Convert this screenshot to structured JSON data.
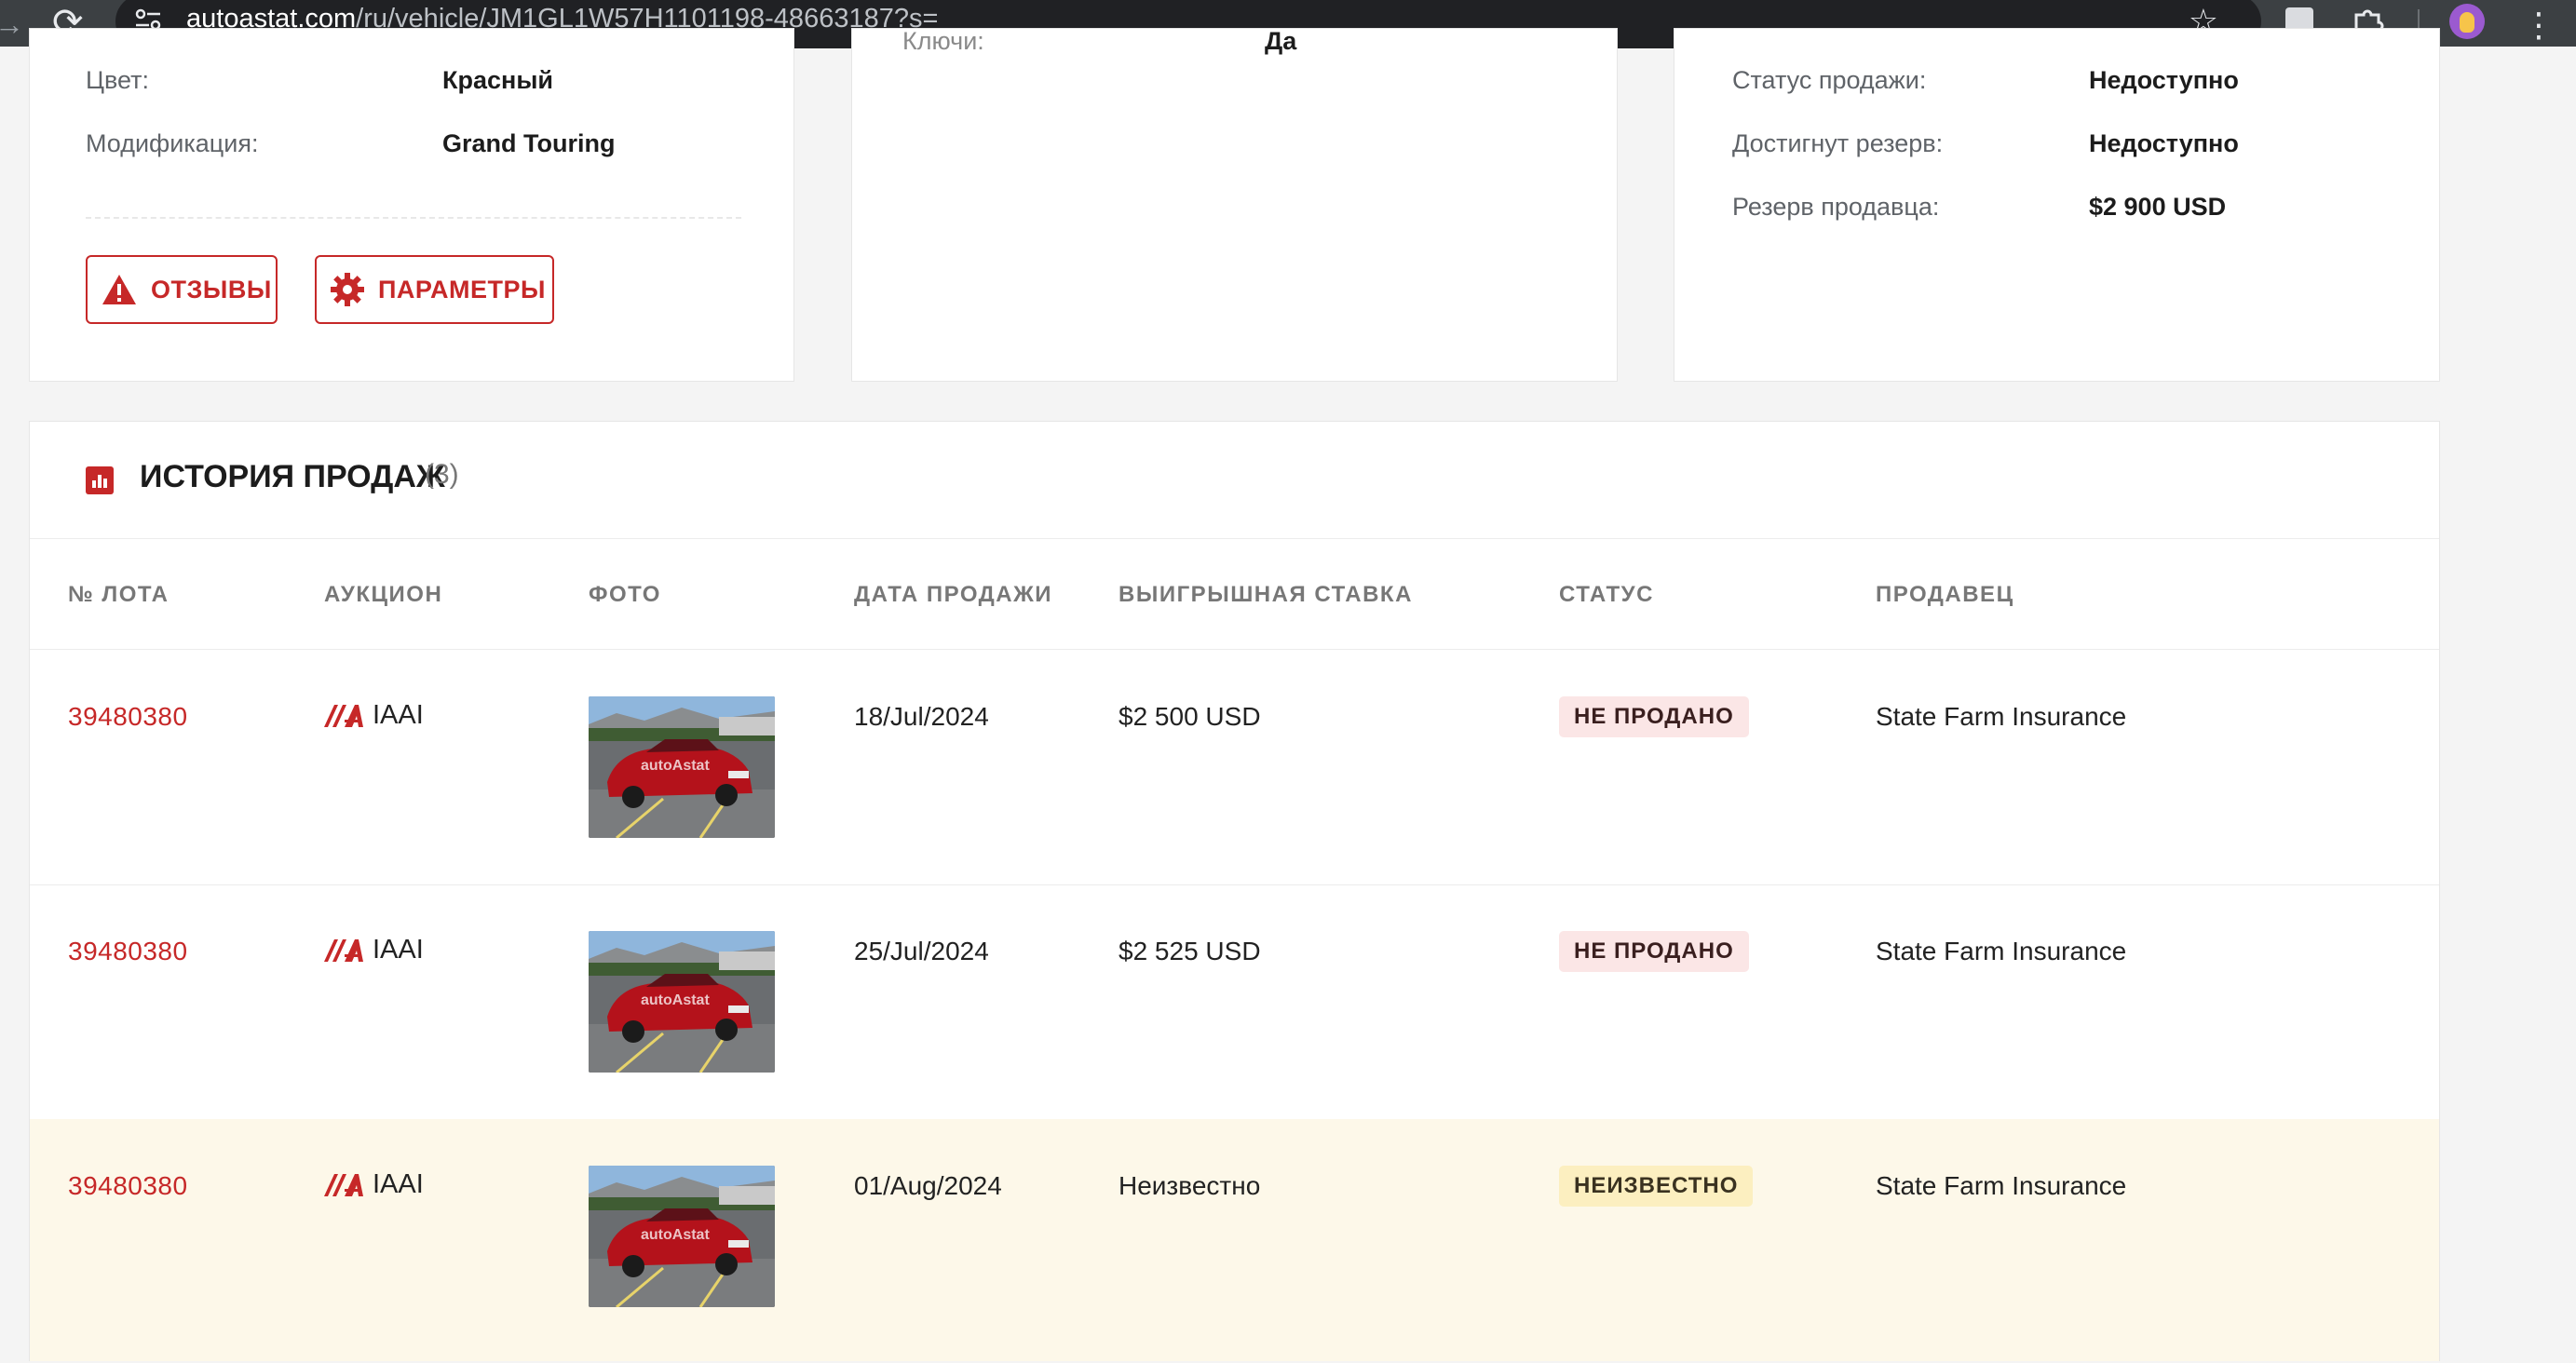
{
  "browser": {
    "url_host": "autoastat.com",
    "url_rest": "/ru/vehicle/JM1GL1W57H1101198-48663187?s="
  },
  "card1": {
    "rows": [
      {
        "label": "Цвет:",
        "value": "Красный"
      },
      {
        "label": "Модификация:",
        "value": "Grand Touring"
      }
    ],
    "buttons": {
      "reviews": "ОТЗЫВЫ",
      "params": "ПАРАМЕТРЫ"
    }
  },
  "card2": {
    "partial_label": "Ключи:",
    "partial_value": "Да"
  },
  "card3": {
    "rows": [
      {
        "label": "Статус продажи:",
        "value": "Недоступно"
      },
      {
        "label": "Достигнут резерв:",
        "value": "Недоступно"
      },
      {
        "label": "Резерв продавца:",
        "value": "$2 900 USD"
      }
    ]
  },
  "history": {
    "title": "ИСТОРИЯ ПРОДАЖ",
    "count": "(3)",
    "columns": [
      "№ ЛОТА",
      "АУКЦИОН",
      "ФОТО",
      "ДАТА ПРОДАЖИ",
      "ВЫИГРЫШНАЯ СТАВКА",
      "СТАТУС",
      "ПРОДАВЕЦ"
    ],
    "photo_watermark": "autoAstat",
    "rows": [
      {
        "lot": "39480380",
        "auction": "IAAI",
        "date": "18/Jul/2024",
        "bid": "$2 500 USD",
        "status": "НЕ ПРОДАНО",
        "seller": "State Farm Insurance"
      },
      {
        "lot": "39480380",
        "auction": "IAAI",
        "date": "25/Jul/2024",
        "bid": "$2 525 USD",
        "status": "НЕ ПРОДАНО",
        "seller": "State Farm Insurance"
      },
      {
        "lot": "39480380",
        "auction": "IAAI",
        "date": "01/Aug/2024",
        "bid": "Неизвестно",
        "status": "НЕИЗВЕСТНО",
        "seller": "State Farm Insurance"
      }
    ]
  },
  "colors": {
    "accent": "#c62828",
    "badge_not_sold_bg": "#fbe6e6",
    "badge_unknown_bg": "#fcefc0",
    "highlight_row_bg": "#fdf8e9"
  }
}
